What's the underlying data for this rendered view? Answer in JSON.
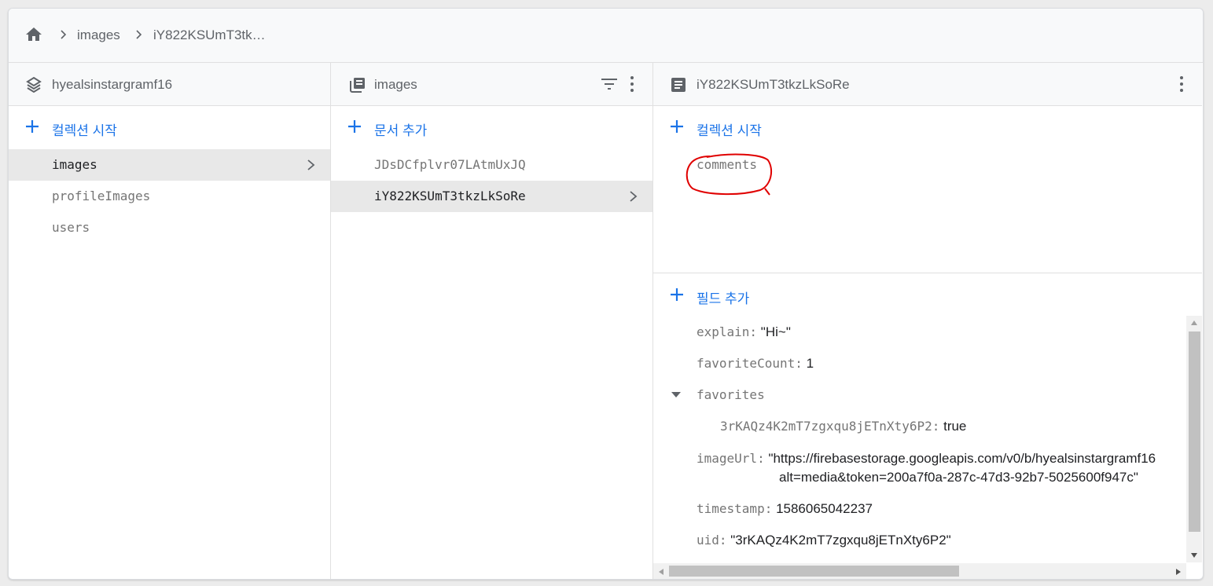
{
  "breadcrumb": {
    "home_icon": "home-icon",
    "items": [
      "images",
      "iY822KSUmT3tk…"
    ]
  },
  "col1": {
    "title": "hyealsinstargramf16",
    "icon": "firestore-database-icon",
    "add_label": "컬렉션 시작",
    "items": [
      "images",
      "profileImages",
      "users"
    ]
  },
  "col2": {
    "title": "images",
    "icon": "collection-icon",
    "add_label": "문서 추가",
    "items": [
      "JDsDCfplvr07LAtmUxJQ",
      "iY822KSUmT3tkzLkSoRe"
    ]
  },
  "col3": {
    "title": "iY822KSUmT3tkzLkSoRe",
    "icon": "document-icon",
    "add_collection_label": "컬렉션 시작",
    "subcollections": [
      "comments"
    ],
    "add_field_label": "필드 추가",
    "fields": {
      "explain_key": "explain:",
      "explain_val": "\"Hi~\"",
      "favoriteCount_key": "favoriteCount:",
      "favoriteCount_val": "1",
      "favorites_key": "favorites",
      "fav_child_key": "3rKAQz4K2mT7zgxqu8jETnXty6P2:",
      "fav_child_val": "true",
      "imageUrl_key": "imageUrl:",
      "imageUrl_val_line1": "\"https://firebasestorage.googleapis.com/v0/b/hyealsinstargramf16",
      "imageUrl_val_line2": "alt=media&token=200a7f0a-287c-47d3-92b7-5025600f947c\"",
      "timestamp_key": "timestamp:",
      "timestamp_val": "1586065042237",
      "uid_key": "uid:",
      "uid_val": "\"3rKAQz4K2mT7zgxqu8jETnXty6P2\""
    }
  },
  "colors": {
    "accent": "#1a73e8",
    "annotation": "#e00000",
    "selected_bg": "#e8e8e8"
  }
}
